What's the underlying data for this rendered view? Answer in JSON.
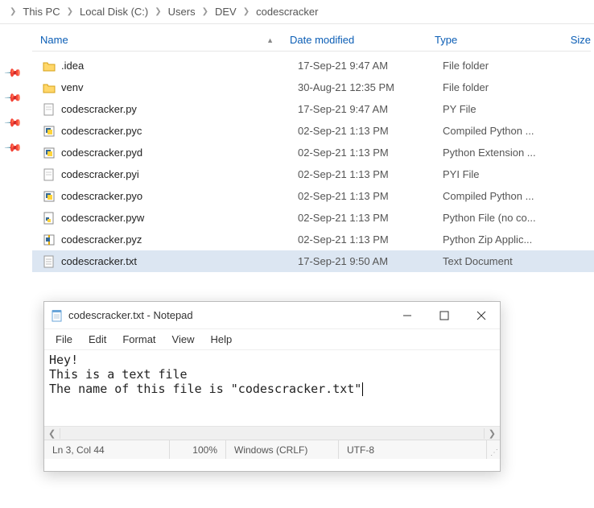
{
  "breadcrumb": {
    "items": [
      "This PC",
      "Local Disk (C:)",
      "Users",
      "DEV",
      "codescracker"
    ]
  },
  "columns": {
    "name": "Name",
    "date": "Date modified",
    "type": "Type",
    "size": "Size"
  },
  "files": [
    {
      "name": ".idea",
      "date": "17-Sep-21 9:47 AM",
      "type": "File folder",
      "icon": "folder"
    },
    {
      "name": "venv",
      "date": "30-Aug-21 12:35 PM",
      "type": "File folder",
      "icon": "folder"
    },
    {
      "name": "codescracker.py",
      "date": "17-Sep-21 9:47 AM",
      "type": "PY File",
      "icon": "file"
    },
    {
      "name": "codescracker.pyc",
      "date": "02-Sep-21 1:13 PM",
      "type": "Compiled Python ...",
      "icon": "pyexe"
    },
    {
      "name": "codescracker.pyd",
      "date": "02-Sep-21 1:13 PM",
      "type": "Python Extension ...",
      "icon": "pyexe"
    },
    {
      "name": "codescracker.pyi",
      "date": "02-Sep-21 1:13 PM",
      "type": "PYI File",
      "icon": "file"
    },
    {
      "name": "codescracker.pyo",
      "date": "02-Sep-21 1:13 PM",
      "type": "Compiled Python ...",
      "icon": "pyexe"
    },
    {
      "name": "codescracker.pyw",
      "date": "02-Sep-21 1:13 PM",
      "type": "Python File (no co...",
      "icon": "pyfile"
    },
    {
      "name": "codescracker.pyz",
      "date": "02-Sep-21 1:13 PM",
      "type": "Python Zip Applic...",
      "icon": "pyzip"
    },
    {
      "name": "codescracker.txt",
      "date": "17-Sep-21 9:50 AM",
      "type": "Text Document",
      "icon": "txt",
      "selected": true
    }
  ],
  "notepad": {
    "title": "codescracker.txt - Notepad",
    "menu": [
      "File",
      "Edit",
      "Format",
      "View",
      "Help"
    ],
    "content": "Hey!\nThis is a text file\nThe name of this file is \"codescracker.txt\"",
    "status": {
      "position": "Ln 3, Col 44",
      "zoom": "100%",
      "eol": "Windows (CRLF)",
      "encoding": "UTF-8"
    }
  }
}
